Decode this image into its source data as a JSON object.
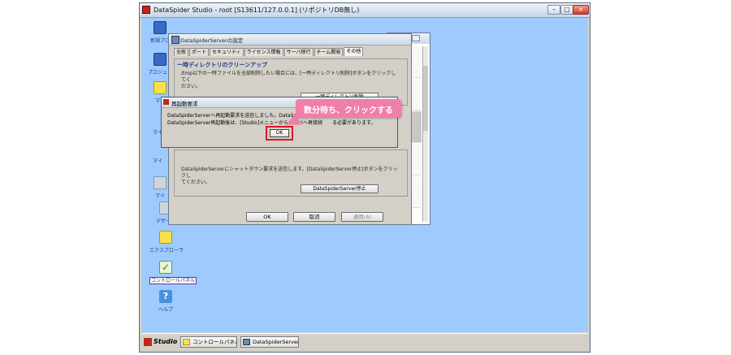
{
  "window": {
    "title": "DataSpider Studio - root [S13611/127.0.0.1] (リポジトリDB無し)"
  },
  "desktop": {
    "icons": [
      {
        "label": "新規プロ"
      },
      {
        "label": "プロジェク"
      },
      {
        "label": "マイ"
      },
      {
        "label": "マイ"
      },
      {
        "label": "マイ"
      },
      {
        "label": "マイ"
      },
      {
        "label": "デザイナ"
      },
      {
        "label": "エクスプローラ"
      },
      {
        "label": "コントロールパネル"
      },
      {
        "label": "ヘルプ"
      }
    ]
  },
  "settings": {
    "title": "DataSpiderServerの設定",
    "tabs": [
      "全般",
      "ポート",
      "セキュリティ",
      "ライセンス情報",
      "サーバ移行",
      "チーム開発",
      "その他"
    ],
    "temp_section": {
      "heading": "一時ディレクトリのクリーンアップ",
      "desc_line1": "/tmp以下の一時ファイルを全部削除したい場合には、[一時ディレクトリ削除]ボタンをクリックしてく",
      "desc_line2": "ださい。",
      "button": "一時ディレクトリ削除"
    },
    "shutdown_section": {
      "desc_line1": "DataSpiderServerにシャットダウン要求を送信します。[DataSpiderServer停止]ボタンをクリックし",
      "desc_line2": "てください。",
      "button": "DataSpiderServer停止"
    },
    "footer": {
      "ok": "OK",
      "cancel": "取消",
      "apply": "適用(A)"
    }
  },
  "restart_dialog": {
    "title": "再起動要求",
    "msg_line1": "DataSpiderServerへ再起動要求を送信しました。DataSpiderS",
    "msg_line2": "DataSpiderServer再起動後は、[Studio]メニューからサーバへ再接続",
    "msg_line2_tail": "る必要があります。",
    "ok": "OK"
  },
  "callout": {
    "text": "数分待ち、クリックする",
    "color": "#ef7fa8"
  },
  "taskbar": {
    "start": "Studio",
    "items": [
      "コントロールパネル",
      "DataSpiderServer..."
    ]
  }
}
